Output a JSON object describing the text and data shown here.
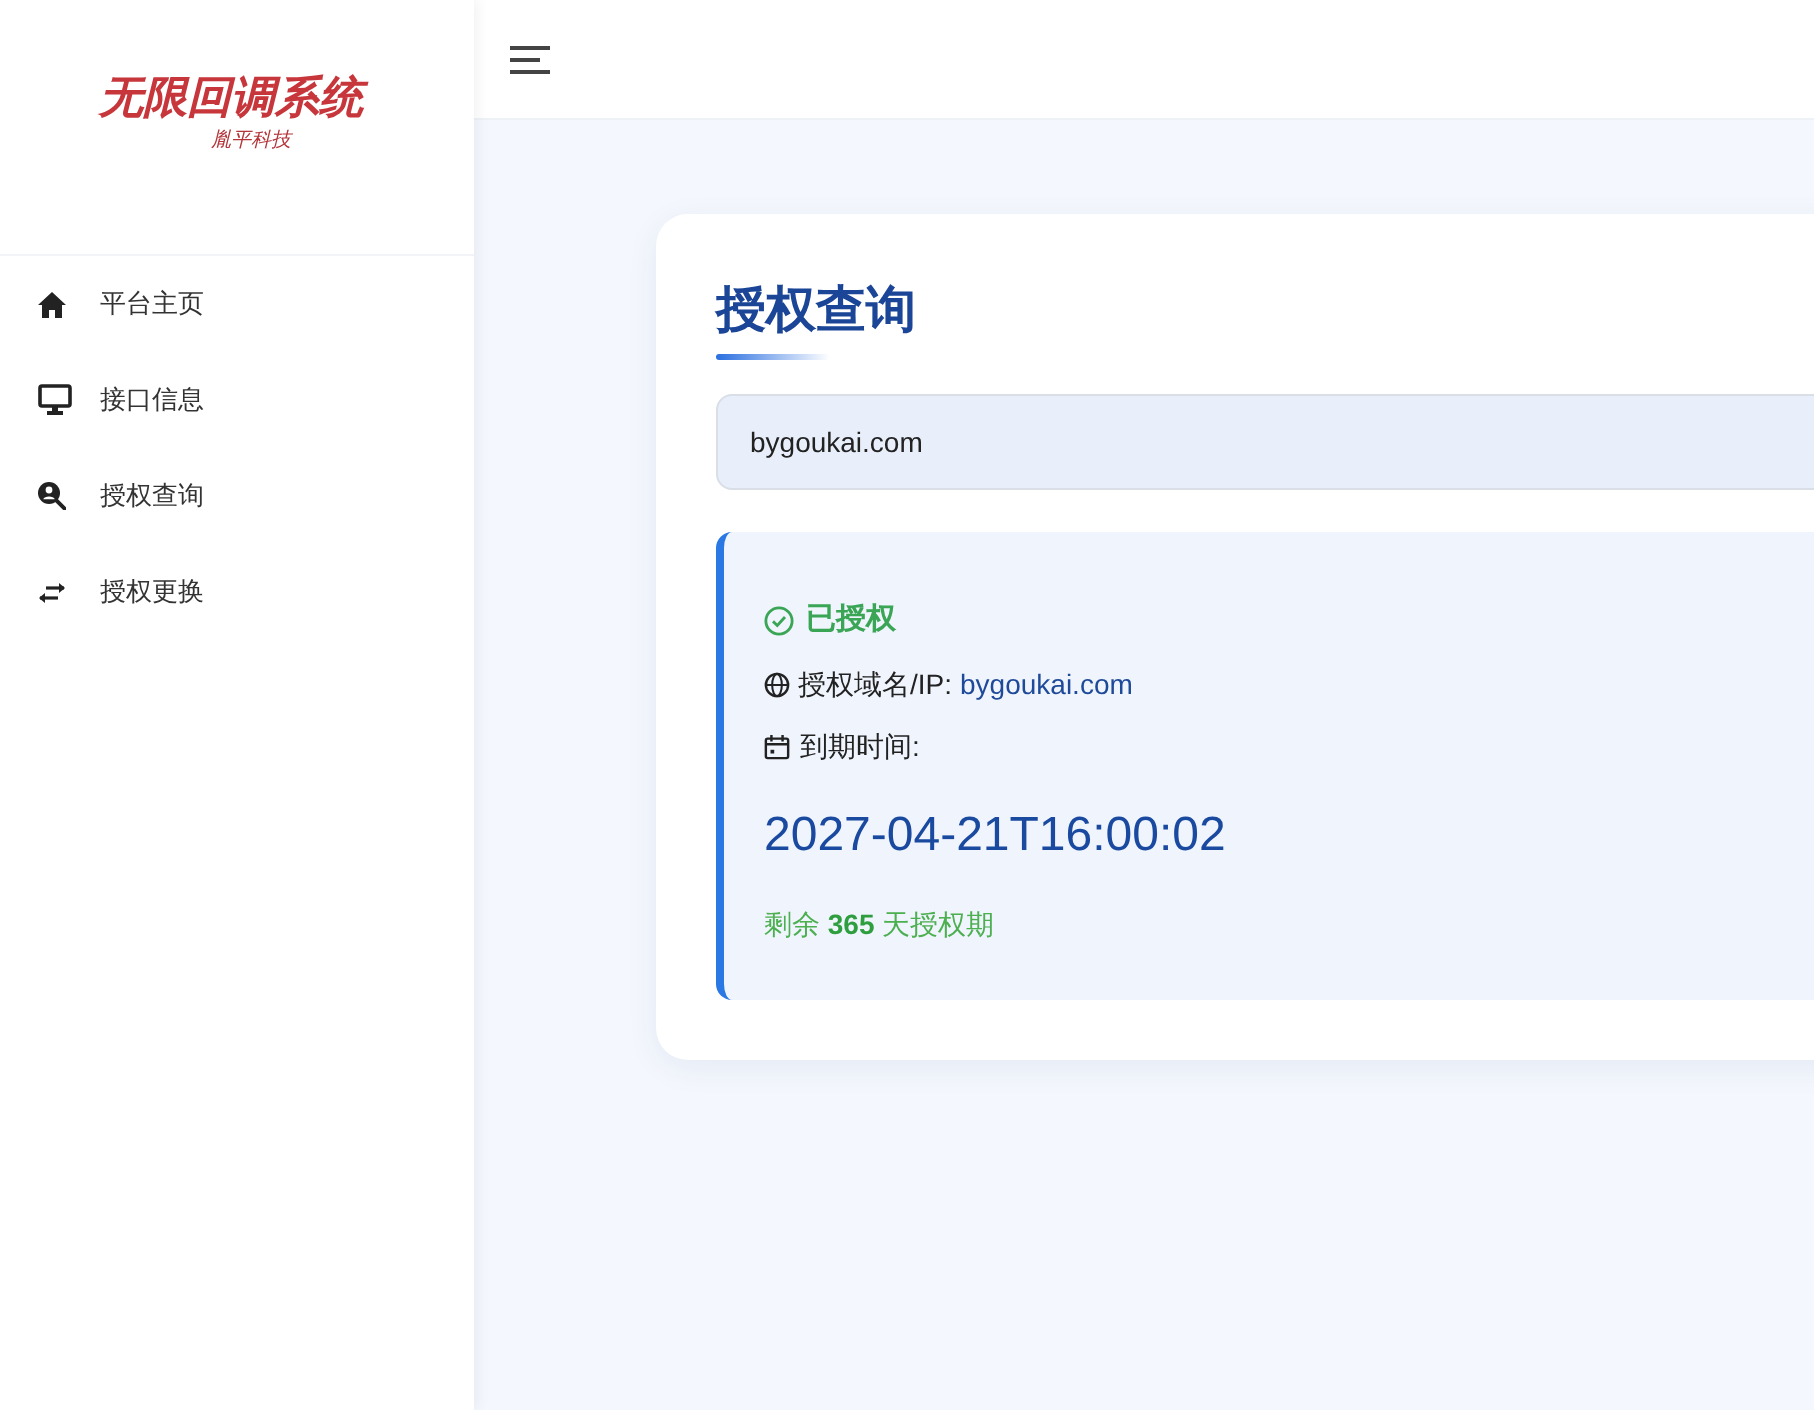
{
  "sidebar": {
    "logo": {
      "title": "无限回调系统",
      "subtitle": "胤平科技"
    },
    "items": [
      {
        "label": "平台主页"
      },
      {
        "label": "接口信息"
      },
      {
        "label": "授权查询"
      },
      {
        "label": "授权更换"
      }
    ]
  },
  "card": {
    "title": "授权查询",
    "query_field": {
      "value": "bygoukai.com"
    },
    "result": {
      "status": "已授权",
      "domain_label": "授权域名/IP:",
      "domain": "bygoukai.com",
      "expiry_label": "到期时间:",
      "expiry": "2027-04-21T16:00:02",
      "remaining": "剩余 **365** 天授权期"
    }
  }
}
